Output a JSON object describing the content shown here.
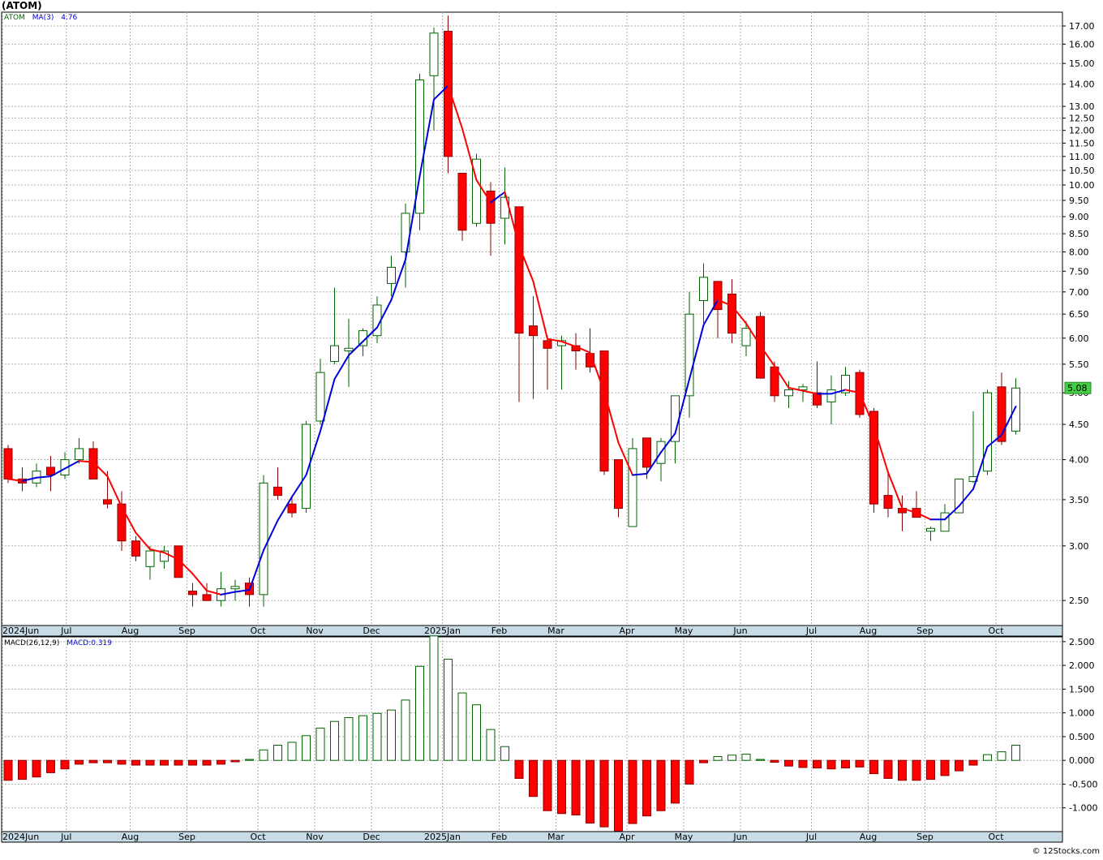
{
  "page": {
    "title": "(ATOM)",
    "copyright": "© 12Stocks.com"
  },
  "colors": {
    "up_candle_stroke": "#006400",
    "down_candle_fill": "#ff0000",
    "ma_up": "#0000dd",
    "ma_down": "#ff0000",
    "grid": "#b0b0b0",
    "axis_band": "#c8dce8",
    "last_price_badge": "#44cc44"
  },
  "chart_data": [
    {
      "type": "candlestick",
      "symbol": "ATOM",
      "legend": {
        "symbol": "ATOM",
        "indicator": "MA(3)",
        "indicator_value": "4.76"
      },
      "last_price_label": "5.08",
      "y_scale": "log",
      "ylim": [
        2.3,
        17.8
      ],
      "y_ticks": [
        "17.00",
        "16.00",
        "15.00",
        "14.00",
        "13.00",
        "12.50",
        "12.00",
        "11.50",
        "11.00",
        "10.50",
        "10.00",
        "9.50",
        "9.00",
        "8.50",
        "8.00",
        "7.50",
        "7.00",
        "6.50",
        "6.00",
        "5.50",
        "5.00",
        "4.50",
        "4.00",
        "3.50",
        "3.00",
        "2.50"
      ],
      "x_month_labels": [
        {
          "label": "2024Jun",
          "week": 0
        },
        {
          "label": "Jul",
          "week": 4.5
        },
        {
          "label": "Aug",
          "week": 9
        },
        {
          "label": "Sep",
          "week": 13
        },
        {
          "label": "Oct",
          "week": 18
        },
        {
          "label": "Nov",
          "week": 22
        },
        {
          "label": "Dec",
          "week": 26
        },
        {
          "label": "2025Jan",
          "week": 31
        },
        {
          "label": "Feb",
          "week": 35
        },
        {
          "label": "Mar",
          "week": 39
        },
        {
          "label": "Apr",
          "week": 44
        },
        {
          "label": "May",
          "week": 48
        },
        {
          "label": "Jun",
          "week": 52
        },
        {
          "label": "Jul",
          "week": 57
        },
        {
          "label": "Aug",
          "week": 61
        },
        {
          "label": "Sep",
          "week": 65
        },
        {
          "label": "Oct",
          "week": 70
        }
      ],
      "weeks_total": 72,
      "ohlc": [
        [
          4.15,
          4.2,
          3.7,
          3.75
        ],
        [
          3.75,
          3.9,
          3.6,
          3.7
        ],
        [
          3.7,
          3.95,
          3.65,
          3.85
        ],
        [
          3.9,
          4.05,
          3.6,
          3.8
        ],
        [
          3.8,
          4.1,
          3.75,
          4.0
        ],
        [
          4.0,
          4.3,
          3.95,
          4.15
        ],
        [
          4.15,
          4.25,
          3.75,
          3.75
        ],
        [
          3.5,
          3.85,
          3.4,
          3.45
        ],
        [
          3.45,
          3.6,
          2.95,
          3.05
        ],
        [
          3.05,
          3.1,
          2.85,
          2.9
        ],
        [
          2.8,
          3.0,
          2.68,
          2.95
        ],
        [
          2.85,
          3.0,
          2.78,
          2.95
        ],
        [
          3.0,
          3.0,
          2.7,
          2.7
        ],
        [
          2.58,
          2.65,
          2.45,
          2.55
        ],
        [
          2.55,
          2.65,
          2.5,
          2.5
        ],
        [
          2.5,
          2.75,
          2.45,
          2.6
        ],
        [
          2.6,
          2.68,
          2.5,
          2.62
        ],
        [
          2.65,
          2.7,
          2.45,
          2.55
        ],
        [
          2.55,
          3.8,
          2.45,
          3.7
        ],
        [
          3.65,
          3.9,
          3.5,
          3.55
        ],
        [
          3.45,
          3.55,
          3.3,
          3.35
        ],
        [
          3.4,
          4.55,
          3.35,
          4.5
        ],
        [
          4.55,
          5.6,
          4.5,
          5.35
        ],
        [
          5.55,
          7.1,
          5.5,
          5.85
        ],
        [
          5.75,
          6.4,
          5.1,
          5.8
        ],
        [
          5.85,
          6.2,
          5.65,
          6.15
        ],
        [
          6.05,
          6.9,
          5.9,
          6.7
        ],
        [
          7.2,
          7.9,
          6.9,
          7.6
        ],
        [
          8.0,
          9.4,
          7.1,
          9.1
        ],
        [
          9.1,
          14.5,
          8.6,
          14.2
        ],
        [
          14.4,
          16.9,
          12.0,
          16.6
        ],
        [
          16.7,
          17.6,
          10.4,
          11.0
        ],
        [
          10.4,
          10.4,
          8.3,
          8.6
        ],
        [
          8.8,
          11.1,
          8.7,
          10.9
        ],
        [
          9.8,
          10.1,
          7.9,
          8.8
        ],
        [
          8.95,
          10.6,
          8.2,
          9.6
        ],
        [
          9.3,
          9.3,
          4.85,
          6.1
        ],
        [
          6.25,
          6.9,
          4.9,
          6.05
        ],
        [
          5.95,
          6.05,
          5.05,
          5.8
        ],
        [
          5.85,
          6.05,
          5.05,
          5.95
        ],
        [
          5.85,
          6.1,
          5.4,
          5.75
        ],
        [
          5.7,
          6.2,
          5.35,
          5.45
        ],
        [
          5.75,
          5.75,
          3.8,
          3.85
        ],
        [
          4.0,
          4.0,
          3.3,
          3.4
        ],
        [
          3.2,
          4.3,
          3.2,
          4.15
        ],
        [
          4.3,
          4.3,
          3.75,
          3.9
        ],
        [
          3.95,
          4.3,
          3.72,
          4.25
        ],
        [
          4.25,
          4.8,
          3.95,
          4.95
        ],
        [
          4.95,
          7.0,
          4.6,
          6.5
        ],
        [
          6.8,
          7.7,
          6.3,
          7.35
        ],
        [
          7.25,
          7.25,
          6.0,
          6.6
        ],
        [
          6.95,
          7.3,
          5.9,
          6.1
        ],
        [
          5.85,
          6.35,
          5.65,
          6.2
        ],
        [
          6.45,
          6.55,
          5.25,
          5.25
        ],
        [
          5.45,
          5.55,
          4.85,
          4.95
        ],
        [
          4.95,
          5.2,
          4.75,
          5.05
        ],
        [
          5.05,
          5.15,
          4.85,
          5.1
        ],
        [
          5.0,
          5.55,
          4.75,
          4.8
        ],
        [
          4.85,
          5.3,
          4.5,
          5.05
        ],
        [
          5.0,
          5.45,
          4.95,
          5.3
        ],
        [
          5.35,
          5.4,
          4.6,
          4.65
        ],
        [
          4.7,
          4.75,
          3.35,
          3.45
        ],
        [
          3.55,
          3.85,
          3.3,
          3.4
        ],
        [
          3.4,
          3.55,
          3.15,
          3.35
        ],
        [
          3.4,
          3.6,
          3.3,
          3.3
        ],
        [
          3.15,
          3.2,
          3.05,
          3.18
        ],
        [
          3.15,
          3.45,
          3.15,
          3.35
        ],
        [
          3.35,
          3.75,
          3.35,
          3.75
        ],
        [
          3.72,
          4.7,
          3.7,
          3.78
        ],
        [
          3.85,
          5.05,
          3.8,
          5.0
        ],
        [
          5.1,
          5.35,
          4.2,
          4.25
        ],
        [
          4.4,
          5.25,
          4.35,
          5.08
        ]
      ]
    },
    {
      "type": "bar",
      "title": "MACD(26,12,9)",
      "legend_value": "MACD:0.319",
      "ylim": [
        -1.5,
        2.6
      ],
      "y_ticks": [
        "2.500",
        "2.000",
        "1.500",
        "1.000",
        "0.500",
        "0.000",
        "-0.500",
        "-1.000"
      ],
      "values": [
        -0.42,
        -0.4,
        -0.35,
        -0.26,
        -0.18,
        -0.08,
        -0.05,
        -0.05,
        -0.08,
        -0.1,
        -0.1,
        -0.1,
        -0.1,
        -0.1,
        -0.1,
        -0.08,
        -0.03,
        0.02,
        0.22,
        0.32,
        0.38,
        0.52,
        0.68,
        0.82,
        0.9,
        0.94,
        0.99,
        1.06,
        1.27,
        1.98,
        2.62,
        2.13,
        1.42,
        1.17,
        0.65,
        0.29,
        -0.38,
        -0.76,
        -1.06,
        -1.12,
        -1.15,
        -1.32,
        -1.4,
        -1.49,
        -1.33,
        -1.17,
        -1.06,
        -0.9,
        -0.5,
        -0.05,
        0.08,
        0.11,
        0.13,
        0.02,
        -0.04,
        -0.12,
        -0.15,
        -0.16,
        -0.18,
        -0.16,
        -0.14,
        -0.28,
        -0.38,
        -0.42,
        -0.42,
        -0.4,
        -0.32,
        -0.22,
        -0.1,
        0.12,
        0.18,
        0.319
      ],
      "x_month_labels": [
        {
          "label": "2024Jun",
          "week": 0
        },
        {
          "label": "Jul",
          "week": 4.5
        },
        {
          "label": "Aug",
          "week": 9
        },
        {
          "label": "Sep",
          "week": 13
        },
        {
          "label": "Oct",
          "week": 18
        },
        {
          "label": "Nov",
          "week": 22
        },
        {
          "label": "Dec",
          "week": 26
        },
        {
          "label": "2025Jan",
          "week": 31
        },
        {
          "label": "Feb",
          "week": 35
        },
        {
          "label": "Mar",
          "week": 39
        },
        {
          "label": "Apr",
          "week": 44
        },
        {
          "label": "May",
          "week": 48
        },
        {
          "label": "Jun",
          "week": 52
        },
        {
          "label": "Jul",
          "week": 57
        },
        {
          "label": "Aug",
          "week": 61
        },
        {
          "label": "Sep",
          "week": 65
        },
        {
          "label": "Oct",
          "week": 70
        }
      ]
    }
  ]
}
